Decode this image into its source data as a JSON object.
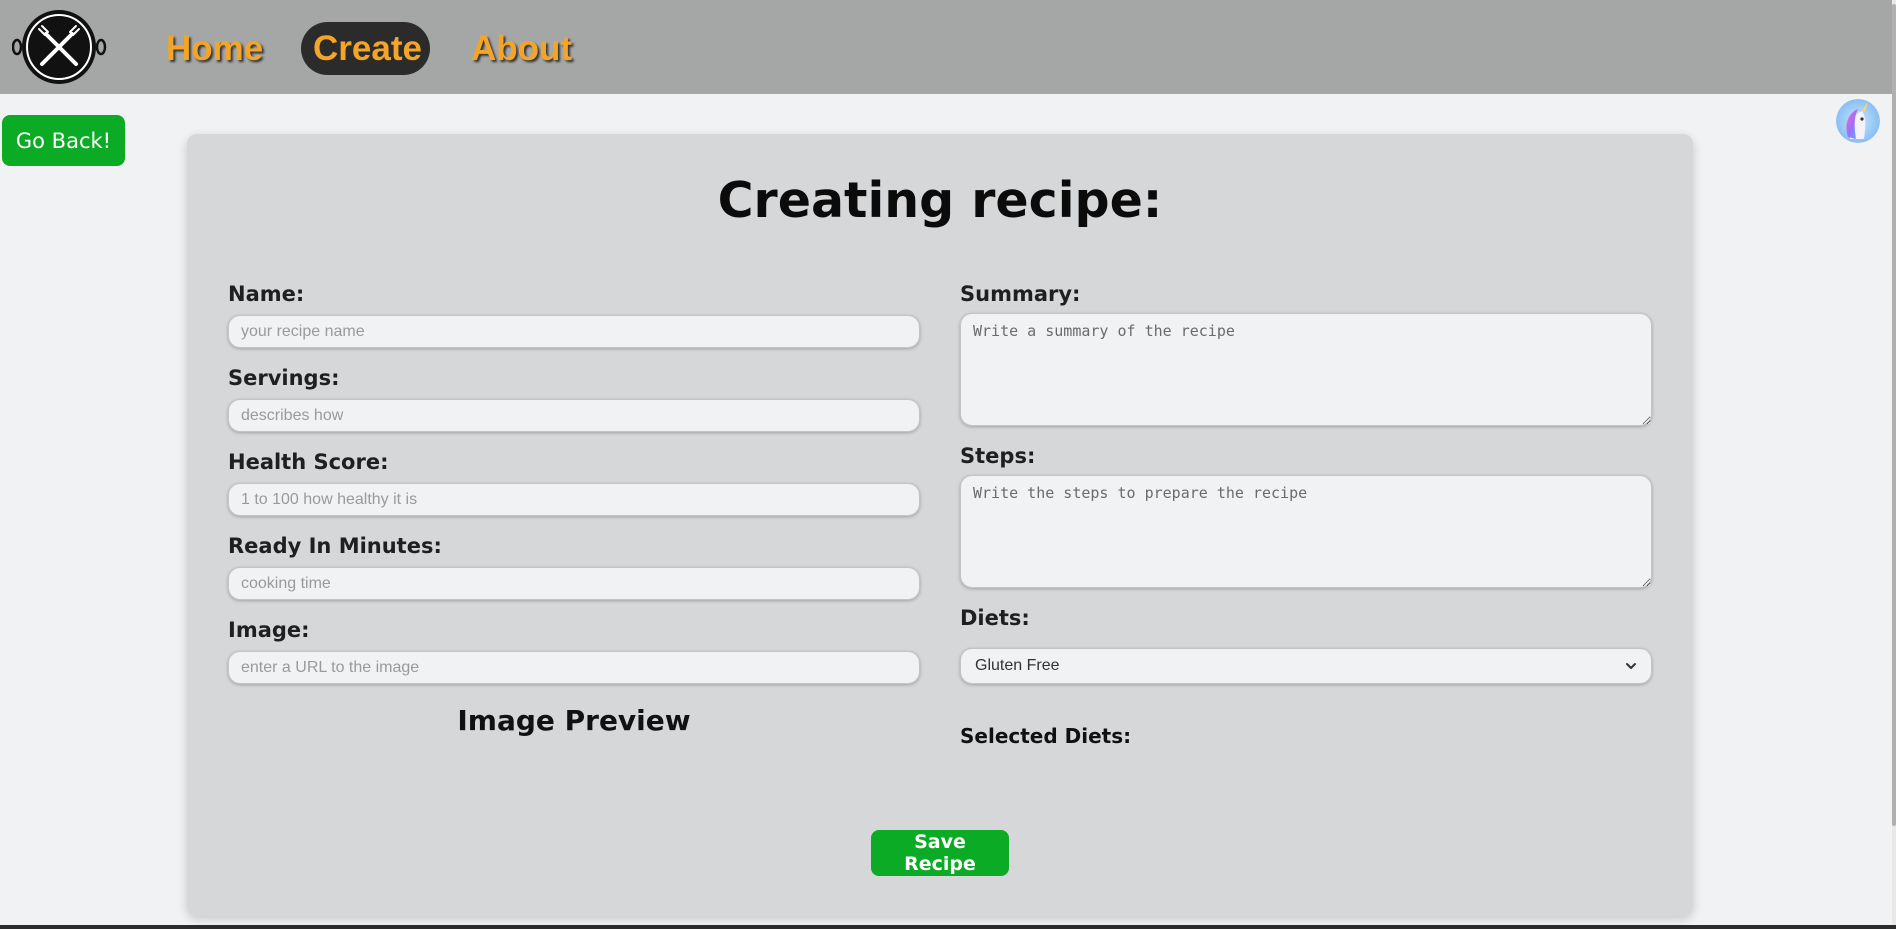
{
  "nav": {
    "links": [
      {
        "label": "Home"
      },
      {
        "label": "Create"
      },
      {
        "label": "About"
      }
    ]
  },
  "actions": {
    "go_back": "Go Back!"
  },
  "form": {
    "title": "Creating recipe:",
    "fields": {
      "name": {
        "label": "Name:",
        "placeholder": "your recipe name",
        "value": ""
      },
      "servings": {
        "label": "Servings:",
        "placeholder": "describes how",
        "value": ""
      },
      "health_score": {
        "label": "Health Score:",
        "placeholder": "1 to 100 how healthy it is",
        "value": ""
      },
      "ready_in_minutes": {
        "label": "Ready In Minutes:",
        "placeholder": "cooking time",
        "value": ""
      },
      "image": {
        "label": "Image:",
        "placeholder": "enter a URL to the image",
        "value": ""
      },
      "summary": {
        "label": "Summary:",
        "placeholder": "Write a summary of the recipe",
        "value": ""
      },
      "steps": {
        "label": "Steps:",
        "placeholder": "Write the steps to prepare the recipe",
        "value": ""
      },
      "diets": {
        "label": "Diets:",
        "selected": "Gluten Free"
      }
    },
    "image_preview_title": "Image Preview",
    "selected_diets_label": "Selected Diets:",
    "save_label": "Save Recipe"
  },
  "colors": {
    "navbar": "#a5a6a6",
    "nav_link": "#f3a52a",
    "active_pill": "#2b2b2b",
    "primary_button": "#0cab25",
    "card": "#d6d7d9",
    "page": "#f1f2f4"
  },
  "icons": {
    "logo": "plate-fork-knife-icon",
    "avatar": "unicorn-avatar",
    "select_caret": "chevron-down-icon"
  }
}
